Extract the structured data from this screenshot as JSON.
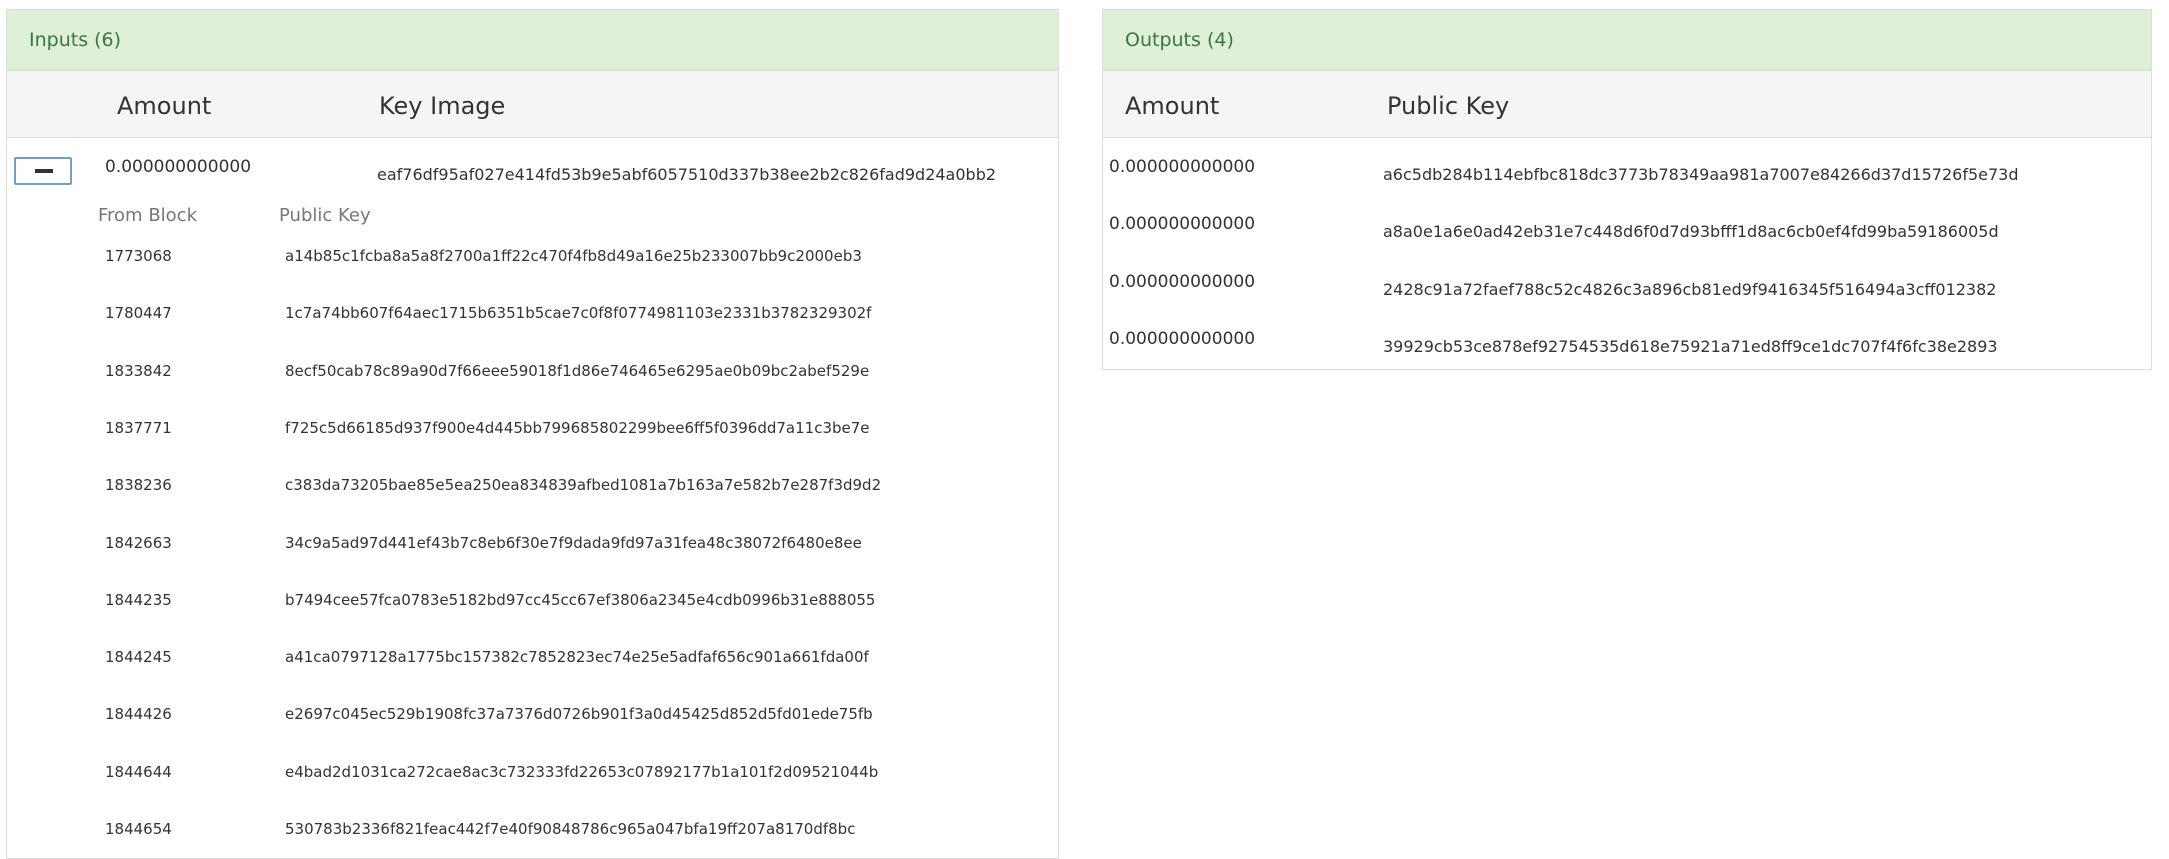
{
  "inputs": {
    "title": "Inputs (6)",
    "col_amount": "Amount",
    "col_key_image": "Key Image",
    "row": {
      "amount": "0.000000000000",
      "key_image": "eaf76df95af027e414fd53b9e5abf6057510d337b38ee2b2c826fad9d24a0bb2"
    },
    "mixins": {
      "col_from_block": "From Block",
      "col_public_key": "Public Key",
      "items": [
        {
          "block": "1773068",
          "key": "a14b85c1fcba8a5a8f2700a1ff22c470f4fb8d49a16e25b233007bb9c2000eb3"
        },
        {
          "block": "1780447",
          "key": "1c7a74bb607f64aec1715b6351b5cae7c0f8f0774981103e2331b3782329302f"
        },
        {
          "block": "1833842",
          "key": "8ecf50cab78c89a90d7f66eee59018f1d86e746465e6295ae0b09bc2abef529e"
        },
        {
          "block": "1837771",
          "key": "f725c5d66185d937f900e4d445bb799685802299bee6ff5f0396dd7a11c3be7e"
        },
        {
          "block": "1838236",
          "key": "c383da73205bae85e5ea250ea834839afbed1081a7b163a7e582b7e287f3d9d2"
        },
        {
          "block": "1842663",
          "key": "34c9a5ad97d441ef43b7c8eb6f30e7f9dada9fd97a31fea48c38072f6480e8ee"
        },
        {
          "block": "1844235",
          "key": "b7494cee57fca0783e5182bd97cc45cc67ef3806a2345e4cdb0996b31e888055"
        },
        {
          "block": "1844245",
          "key": "a41ca0797128a1775bc157382c7852823ec74e25e5adfaf656c901a661fda00f"
        },
        {
          "block": "1844426",
          "key": "e2697c045ec529b1908fc37a7376d0726b901f3a0d45425d852d5fd01ede75fb"
        },
        {
          "block": "1844644",
          "key": "e4bad2d1031ca272cae8ac3c732333fd22653c07892177b1a101f2d09521044b"
        },
        {
          "block": "1844654",
          "key": "530783b2336f821feac442f7e40f90848786c965a047bfa19ff207a8170df8bc"
        }
      ]
    }
  },
  "outputs": {
    "title": "Outputs (4)",
    "col_amount": "Amount",
    "col_public_key": "Public Key",
    "rows": [
      {
        "amount": "0.000000000000",
        "key": "a6c5db284b114ebfbc818dc3773b78349aa981a7007e84266d37d15726f5e73d"
      },
      {
        "amount": "0.000000000000",
        "key": "a8a0e1a6e0ad42eb31e7c448d6f0d7d93bfff1d8ac6cb0ef4fd99ba59186005d"
      },
      {
        "amount": "0.000000000000",
        "key": "2428c91a72faef788c52c4826c3a896cb81ed9f9416345f516494a3cff012382"
      },
      {
        "amount": "0.000000000000",
        "key": "39929cb53ce878ef92754535d618e75921a71ed8ff9ce1dc707f4f6fc38e2893"
      }
    ]
  },
  "icons": {
    "collapse": "minus-icon"
  },
  "colors": {
    "heading_bg": "#dff0d8",
    "heading_text": "#3c763d",
    "header_row_bg": "#f5f5f5",
    "border": "#dddddd",
    "button_border": "#6f9fcf"
  }
}
